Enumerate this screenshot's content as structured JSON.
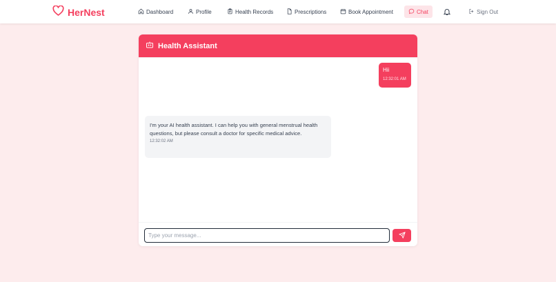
{
  "brand": {
    "name": "HerNest",
    "accent_color": "#f43f5e"
  },
  "nav": {
    "items": [
      {
        "label": "Dashboard",
        "icon": "home-icon"
      },
      {
        "label": "Profile",
        "icon": "user-icon"
      },
      {
        "label": "Health Records",
        "icon": "clipboard-icon"
      },
      {
        "label": "Prescriptions",
        "icon": "file-icon"
      },
      {
        "label": "Book Appointment",
        "icon": "calendar-icon"
      },
      {
        "label": "Chat",
        "icon": "chat-icon",
        "active": true
      }
    ],
    "notifications_icon": "bell-icon",
    "sign_out": {
      "label": "Sign Out",
      "icon": "sign-out-icon"
    }
  },
  "chat": {
    "title": "Health Assistant",
    "header_icon": "robot-icon",
    "messages": [
      {
        "sender": "user",
        "text": "Hii",
        "time": "12:32:01 AM"
      },
      {
        "sender": "assistant",
        "text": "I'm your AI health assistant. I can help you with general menstrual health questions, but please consult a doctor for specific medical advice.",
        "time": "12:32:02 AM"
      }
    ],
    "input": {
      "placeholder": "Type your message...",
      "value": ""
    },
    "send_icon": "send-icon"
  }
}
